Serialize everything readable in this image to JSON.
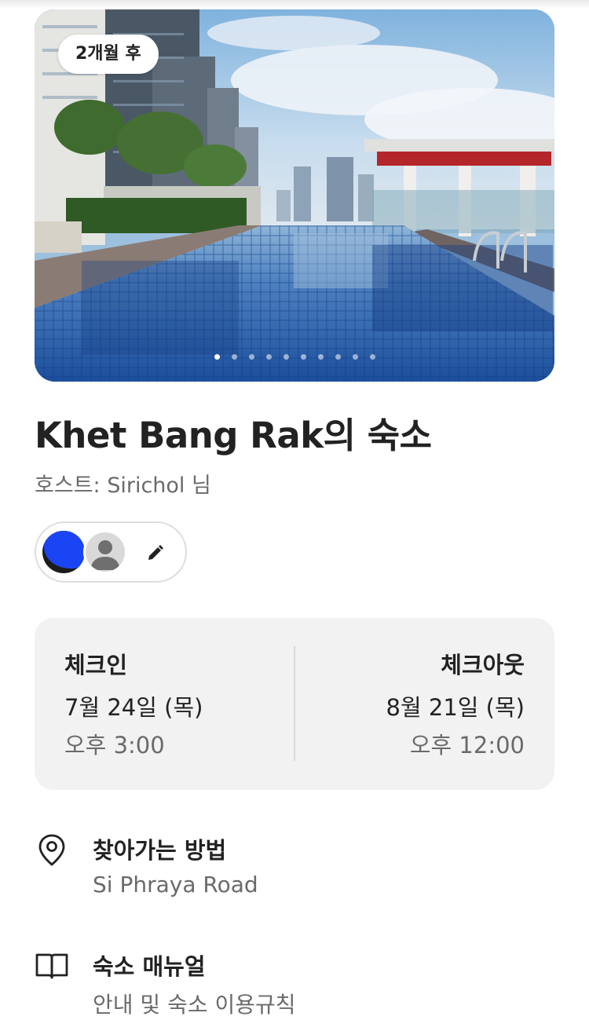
{
  "hero": {
    "badge": "2개월 후",
    "image_alt": "rooftop swimming pool with city skyline",
    "photo_count": 10,
    "active_index": 0
  },
  "listing": {
    "title": "Khet Bang Rak의 숙소",
    "host": "호스트: Sirichol 님"
  },
  "guests": {
    "avatars": [
      "guest-avatar-blue",
      "guest-avatar-default"
    ],
    "edit_icon": "pencil-icon"
  },
  "checkin": {
    "label": "체크인",
    "date": "7월 24일 (목)",
    "time": "오후 3:00"
  },
  "checkout": {
    "label": "체크아웃",
    "date": "8월 21일 (목)",
    "time": "오후 12:00"
  },
  "directions": {
    "icon": "location-pin-icon",
    "title": "찾아가는 방법",
    "subtitle": "Si Phraya Road"
  },
  "manual": {
    "icon": "book-icon",
    "title": "숙소 매뉴얼",
    "subtitle": "안내 및 숙소 이용규칙"
  },
  "colors": {
    "text": "#222222",
    "muted": "#6a6a6a",
    "card": "#f2f2f2",
    "avatar_blue": "#1b45f4"
  }
}
